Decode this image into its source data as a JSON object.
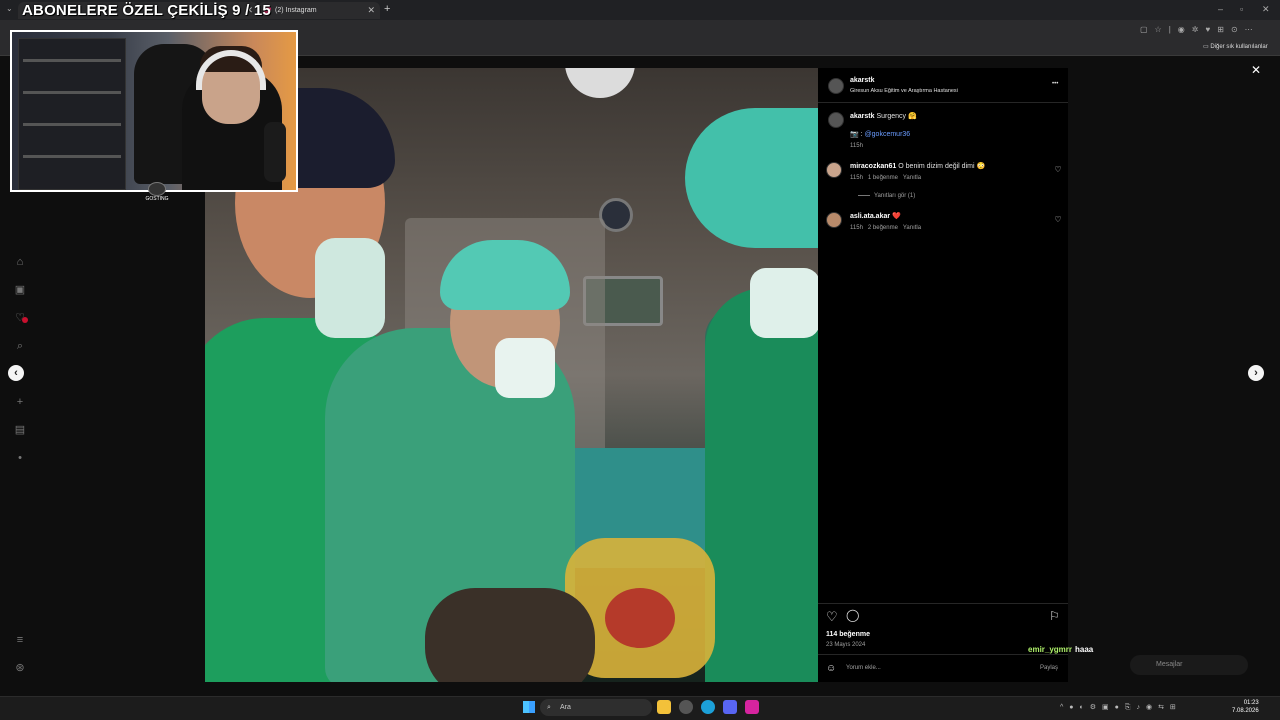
{
  "overlay": {
    "title": "ABONELERE ÖZEL ÇEKİLİŞ 9 / 15"
  },
  "browser": {
    "tab_active_label": "(2) Instagram",
    "new_tab": "+",
    "bookmarks_other": "Diğer sık kullanılanlar"
  },
  "webcam": {
    "logo_text": "GOSTING"
  },
  "post": {
    "author": "akarstk",
    "location": "Giresun Aksu Eğitim ve Araştırma Hastanesi",
    "more": "•••",
    "caption": {
      "user": "akarstk",
      "text": "Surgency 🤗",
      "camera": "📷 :",
      "mention": "@gokcemur36",
      "time": "115h"
    },
    "comments": [
      {
        "user": "miracozkan61",
        "text": "O benim dizim değil dimi 😳",
        "time": "115h",
        "likes": "1 beğenme",
        "reply": "Yanıtla"
      },
      {
        "user": "asli.ata.akar",
        "text": "❤️",
        "time": "115h",
        "likes": "2 beğenme",
        "reply": "Yanıtla"
      }
    ],
    "view_replies": "Yanıtları gör (1)",
    "likes": "114 beğenme",
    "date": "23 Mayıs 2024",
    "comment_placeholder": "Yorum ekle...",
    "share": "Paylaş"
  },
  "chat": {
    "user": "emir_ygmrr",
    "message": "haaa"
  },
  "messages": {
    "label": "Mesajlar"
  },
  "taskbar": {
    "search": "Ara",
    "time": "01:23",
    "date": "7.08.2026"
  },
  "icons": [
    "home-icon",
    "reels-icon",
    "notifications-icon",
    "search-icon",
    "create-icon",
    "dashboard-icon",
    "more-icon",
    "heart-icon",
    "comment-icon",
    "bookmark-icon",
    "emoji-icon",
    "close-icon",
    "chevron-left-icon",
    "chevron-right-icon"
  ],
  "colors": {
    "panel_bg": "#000000",
    "link": "#6a9cff",
    "chat_user": "#aef06a",
    "scrubs": "#1fa36b",
    "cap": "#35c4b0"
  }
}
